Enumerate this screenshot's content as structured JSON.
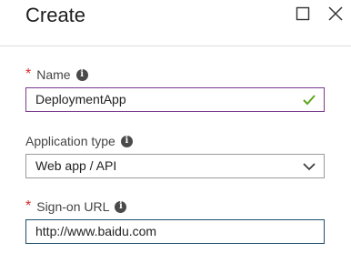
{
  "header": {
    "title": "Create",
    "maximize_icon": "square-maximize-icon",
    "close_icon": "close-x-icon"
  },
  "form": {
    "name": {
      "required_mark": "*",
      "label": "Name",
      "value": "DeploymentApp",
      "status_icon": "check-icon",
      "status_color": "#5ea51c"
    },
    "app_type": {
      "label": "Application type",
      "selected": "Web app / API",
      "dropdown_icon": "chevron-down-icon"
    },
    "signon_url": {
      "required_mark": "*",
      "label": "Sign-on URL",
      "value": "http://www.baidu.com"
    }
  },
  "colors": {
    "required": "#d62b2b",
    "focus_border_name": "#7a3a8c",
    "focus_border_url": "#1e4f6e"
  }
}
